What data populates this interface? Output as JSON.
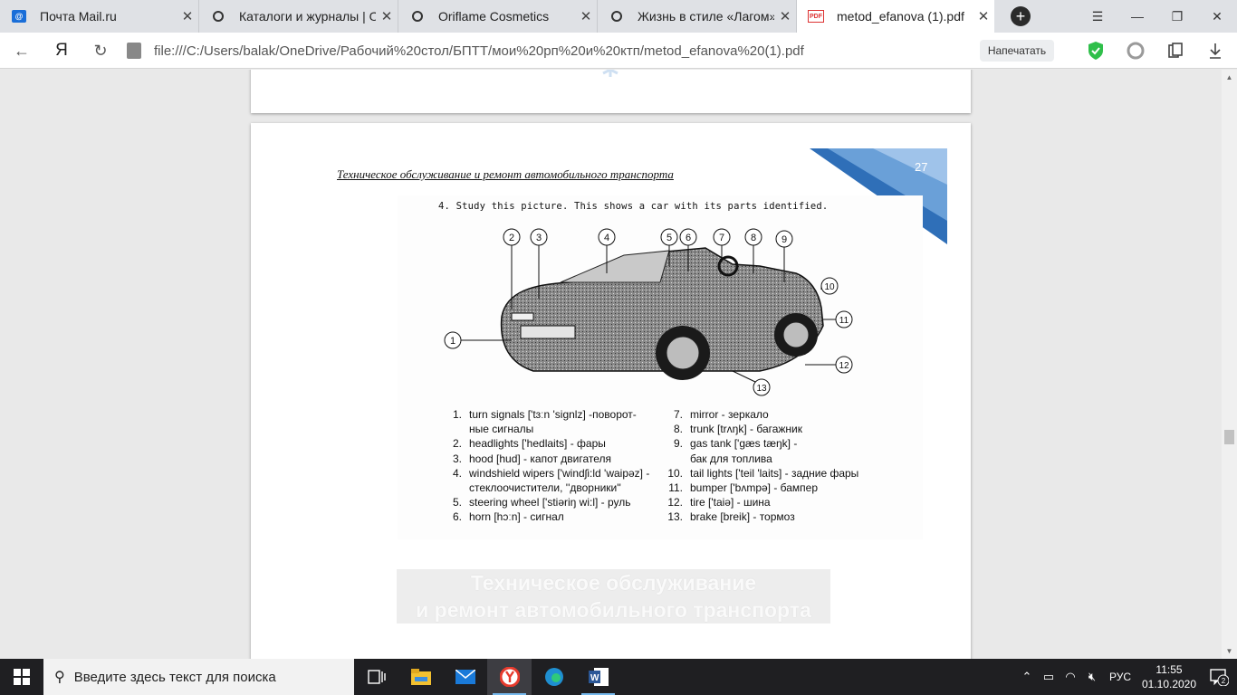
{
  "tabs": [
    {
      "label": "Почта Mail.ru",
      "icon": "mail-ru-icon",
      "active": false
    },
    {
      "label": "Каталоги и журналы | Or",
      "icon": "loading-ring-icon",
      "active": false
    },
    {
      "label": "Oriflame Cosmetics",
      "icon": "loading-ring-icon",
      "active": false
    },
    {
      "label": "Жизнь в стиле «Лагом»:",
      "icon": "loading-ring-icon",
      "active": false
    },
    {
      "label": "metod_efanova (1).pdf",
      "icon": "pdf-icon",
      "active": true
    }
  ],
  "tab_close_glyph": "✕",
  "newtab_glyph": "+",
  "address": {
    "url": "file:///C:/Users/balak/OneDrive/Рабочий%20стол/БПТТ/мои%20рп%20и%20ктп/metod_efanova%20(1).pdf",
    "print_label": "Напечатать",
    "yandex_glyph": "Я"
  },
  "pdf": {
    "header": "Техническое обслуживание и ремонт автомобильного транспорта",
    "page_number": "27",
    "exercise_title": "4. Study this picture. This shows a car with its parts identified.",
    "callouts": [
      "1",
      "2",
      "3",
      "4",
      "5",
      "6",
      "7",
      "8",
      "9",
      "10",
      "11",
      "12",
      "13"
    ],
    "parts_left": [
      {
        "num": "1.",
        "text": "turn signals ['tɜːn 'signlz] -поворот-"
      },
      {
        "num": "",
        "text": "ные сигналы"
      },
      {
        "num": "2.",
        "text": "headlights ['hedlaits] - фары"
      },
      {
        "num": "3.",
        "text": "hood [hud] - капот двигателя"
      },
      {
        "num": "4.",
        "text": "windshield wipers ['windʃi:ld 'waipəz] -"
      },
      {
        "num": "",
        "text": "стеклоочистители, ''дворники''"
      },
      {
        "num": "5.",
        "text": "steering wheel ['stiəriŋ wi:l] - руль"
      },
      {
        "num": "6.",
        "text": "horn [hɔːn] - сигнал"
      }
    ],
    "parts_right": [
      {
        "num": "7.",
        "text": "mirror - зеркало"
      },
      {
        "num": "8.",
        "text": "trunk [trʌŋk] - багажник"
      },
      {
        "num": "9.",
        "text": "gas tank ['gæs tæŋk] -"
      },
      {
        "num": "",
        "text": "бак для топлива"
      },
      {
        "num": "10.",
        "text": "tail lights ['teil 'laits] - задние фары"
      },
      {
        "num": "11.",
        "text": "bumper ['bʌmpə] - бампер"
      },
      {
        "num": "12.",
        "text": "tire ['taiə] - шина"
      },
      {
        "num": "13.",
        "text": "brake [breik] - тормоз"
      }
    ],
    "watermark_line1": "Техническое обслуживание",
    "watermark_line2": "и ремонт автомобильного транспорта"
  },
  "taskbar": {
    "search_placeholder": "Введите здесь текст для поиска",
    "language": "РУС",
    "time": "11:55",
    "date": "01.10.2020",
    "notification_count": "2"
  },
  "colors": {
    "accent_blue": "#4a86c8",
    "tabbar": "#dfe1e5",
    "taskbar": "#1f1f22"
  }
}
